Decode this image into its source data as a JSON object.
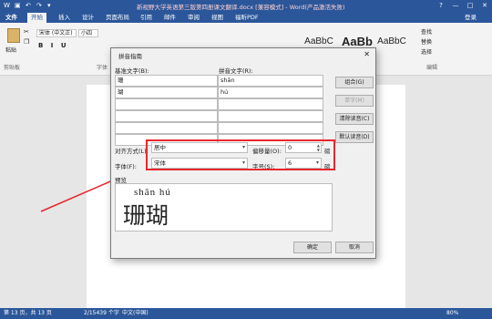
{
  "window": {
    "title": "新视野大学英语第三版第四册课文翻译.docx [兼容模式] - Word(产品激活失败)",
    "controls": [
      "?",
      "—",
      "□",
      "✕"
    ]
  },
  "tabs": {
    "file": "文件",
    "items": [
      "开始",
      "插入",
      "设计",
      "页面布局",
      "引用",
      "邮件",
      "审阅",
      "视图",
      "福昕PDF"
    ],
    "login": "登录"
  },
  "ribbon": {
    "paste_label": "粘贴",
    "clipboard_group": "剪贴板",
    "font_group": "字体",
    "editing_group": "编辑",
    "font_name": "宋体 (中文正)",
    "font_size": "小四",
    "styles": [
      "AaBbC",
      "AaBb",
      "AaBbC"
    ],
    "edit_items": [
      "查找",
      "替换",
      "选择"
    ]
  },
  "dialog": {
    "title": "拼音指南",
    "close": "✕",
    "base_text_label": "基准文字(B):",
    "ruby_text_label": "拼音文字(R):",
    "rows": [
      {
        "base": "珊",
        "ruby": "shān"
      },
      {
        "base": "瑚",
        "ruby": "hú"
      },
      {
        "base": "",
        "ruby": ""
      },
      {
        "base": "",
        "ruby": ""
      },
      {
        "base": "",
        "ruby": ""
      },
      {
        "base": "",
        "ruby": ""
      }
    ],
    "buttons": {
      "combine": "组合(G)",
      "separate": "单字(M)",
      "clear": "清除读音(C)",
      "default": "默认读音(D)",
      "ok": "确定",
      "cancel": "取消"
    },
    "alignment_label": "对齐方式(L):",
    "alignment_value": "居中",
    "offset_label": "偏移量(O):",
    "offset_value": "0",
    "offset_unit": "磅",
    "font_label": "字体(F):",
    "font_value": "宋体",
    "size_label": "字号(S):",
    "size_value": "6",
    "size_unit": "磅",
    "preview_label": "预览",
    "preview_pinyin": "shān  hú",
    "preview_hanzi": "珊瑚"
  },
  "status": {
    "page": "第 13 页，共 13 页",
    "words": "2/15439 个字",
    "lang": "中文(中国)",
    "zoom": "80%"
  },
  "colors": {
    "accent": "#2b579a",
    "highlight": "#e8272e"
  }
}
